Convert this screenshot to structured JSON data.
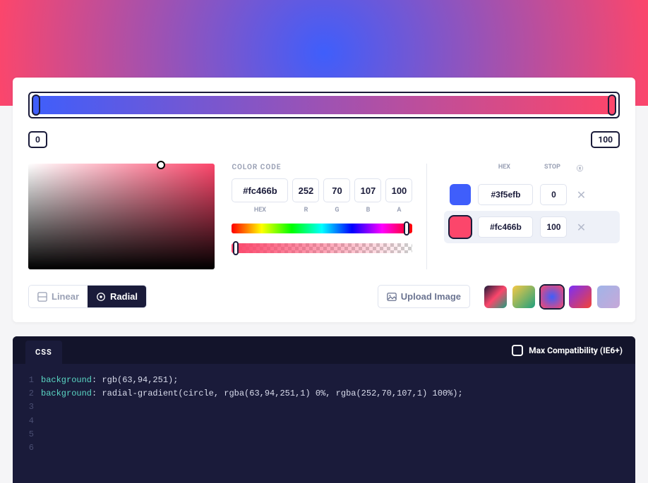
{
  "gradient": {
    "stops_axis": {
      "left": "0",
      "right": "100"
    }
  },
  "color_code": {
    "label": "COLOR CODE",
    "hex": "#fc466b",
    "r": "252",
    "g": "70",
    "b": "107",
    "a": "100",
    "sub": {
      "hex": "HEX",
      "r": "R",
      "g": "G",
      "b": "B",
      "a": "A"
    }
  },
  "stops": {
    "head": {
      "hex": "HEX",
      "stop": "STOP",
      "del": "ⓧ"
    },
    "rows": [
      {
        "color": "#3f5efb",
        "hex": "#3f5efb",
        "stop": "0",
        "active": false
      },
      {
        "color": "#fc466b",
        "hex": "#fc466b",
        "stop": "100",
        "active": true
      }
    ]
  },
  "modes": {
    "linear": "Linear",
    "radial": "Radial"
  },
  "upload": "Upload Image",
  "presets": [
    {
      "bg": "linear-gradient(135deg,#1a1b3a,#fc466b,#1ea07e)"
    },
    {
      "bg": "linear-gradient(135deg,#f6c945,#1ea07e)"
    },
    {
      "bg": "radial-gradient(circle,#3f5efb,#fc466b)",
      "selected": true
    },
    {
      "bg": "linear-gradient(135deg,#7b2ff7,#f44336)"
    },
    {
      "bg": "linear-gradient(135deg,#a0b4e8,#c7a8d8)"
    }
  ],
  "code": {
    "tab": "CSS",
    "maxcomp": "Max Compatibility (IE6+)",
    "lines": [
      {
        "kw": "background",
        "rest": ": rgb(63,94,251);"
      },
      {
        "kw": "background",
        "rest": ": radial-gradient(circle, rgba(63,94,251,1) 0%, rgba(252,70,107,1) 100%);"
      }
    ]
  }
}
